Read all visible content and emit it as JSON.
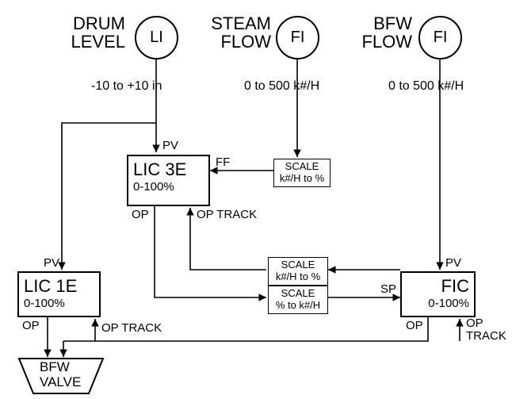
{
  "inputs": {
    "drum_level": {
      "header1": "DRUM",
      "header2": "LEVEL",
      "tag": "LI",
      "range": "-10 to +10 in"
    },
    "steam_flow": {
      "header1": "STEAM",
      "header2": "FLOW",
      "tag": "FI",
      "range": "0 to 500 k#/H"
    },
    "bfw_flow": {
      "header1": "BFW",
      "header2": "FLOW",
      "tag": "FI",
      "range": "0 to 500 k#/H"
    }
  },
  "blocks": {
    "lic3e": {
      "name": "LIC 3E",
      "range": "0-100%",
      "pv": "PV",
      "ff": "FF",
      "op": "OP",
      "op_track": "OP TRACK"
    },
    "lic1e": {
      "name": "LIC 1E",
      "range": "0-100%",
      "pv": "PV",
      "op": "OP",
      "op_track": "OP TRACK"
    },
    "fic": {
      "name": "FIC",
      "range": "0-100%",
      "pv": "PV",
      "sp": "SP",
      "op": "OP",
      "op_track1": "OP",
      "op_track2": "TRACK"
    }
  },
  "scales": {
    "s1": {
      "line1": "SCALE",
      "line2": "k#/H to %"
    },
    "s2": {
      "line1": "SCALE",
      "line2": "k#/H to %"
    },
    "s3": {
      "line1": "SCALE",
      "line2": "% to k#/H"
    }
  },
  "valve": {
    "line1": "BFW",
    "line2": "VALVE"
  }
}
